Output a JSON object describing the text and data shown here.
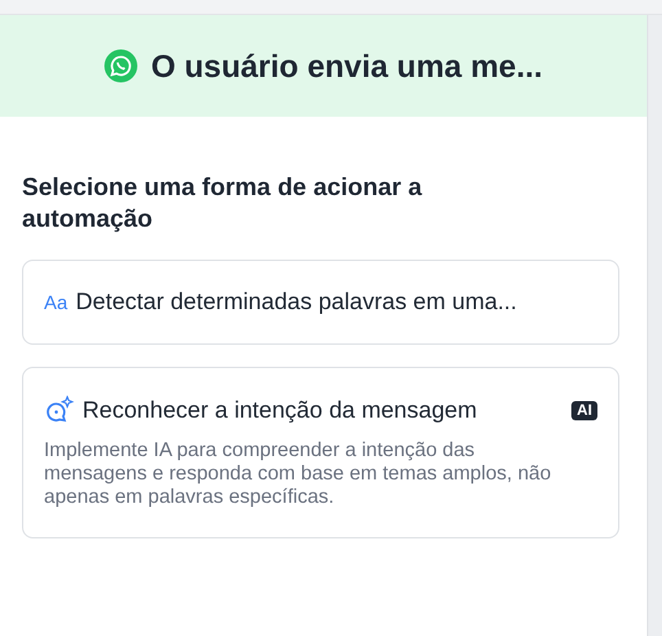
{
  "header": {
    "title": "O usuário envia uma me..."
  },
  "prompt": "Selecione uma forma de acionar a automação",
  "options": [
    {
      "kind": "keyword",
      "icon_text": "Aa",
      "title": "Detectar determinadas palavras em uma..."
    },
    {
      "kind": "ai",
      "title": "Reconhecer a intenção da mensagem",
      "badge": "AI",
      "description": "Implemente IA para compreender a intenção das mensagens e responda com base em temas amplos, não apenas em palavras específicas."
    }
  ]
}
